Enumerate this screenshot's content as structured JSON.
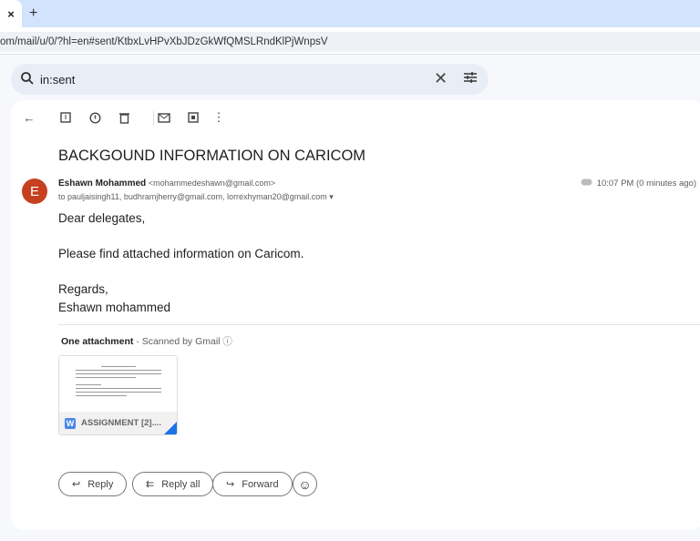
{
  "browser": {
    "tab_close": "×",
    "new_tab": "+",
    "url": "om/mail/u/0/?hl=en#sent/KtbxLvHPvXbJDzGkWfQMSLRndKlPjWnpsV"
  },
  "search": {
    "value": "in:sent",
    "clear": "✕"
  },
  "email": {
    "subject": "BACKGOUND INFORMATION ON CARICOM",
    "avatar_letter": "E",
    "sender_name": "Eshawn Mohammed",
    "sender_email": "<mohammedeshawn@gmail.com>",
    "recipients": "to pauljaisingh11, budhramjherry@gmail.com, lorrexhyman20@gmail.com",
    "time": "10:07 PM (0 minutes ago)",
    "body": [
      "Dear delegates,",
      "Please find attached information on Caricom.",
      "Regards,",
      "Eshawn mohammed"
    ],
    "attachment_header": "One attachment",
    "scanned": "Scanned by Gmail",
    "attachment_name": "ASSIGNMENT [2]....",
    "attachment_icon": "W"
  },
  "actions": {
    "reply": "Reply",
    "reply_all": "Reply all",
    "forward": "Forward"
  },
  "colors": {
    "avatar": "#c6401f",
    "tabbar": "#d3e3fd",
    "accent": "#1a73e8"
  }
}
